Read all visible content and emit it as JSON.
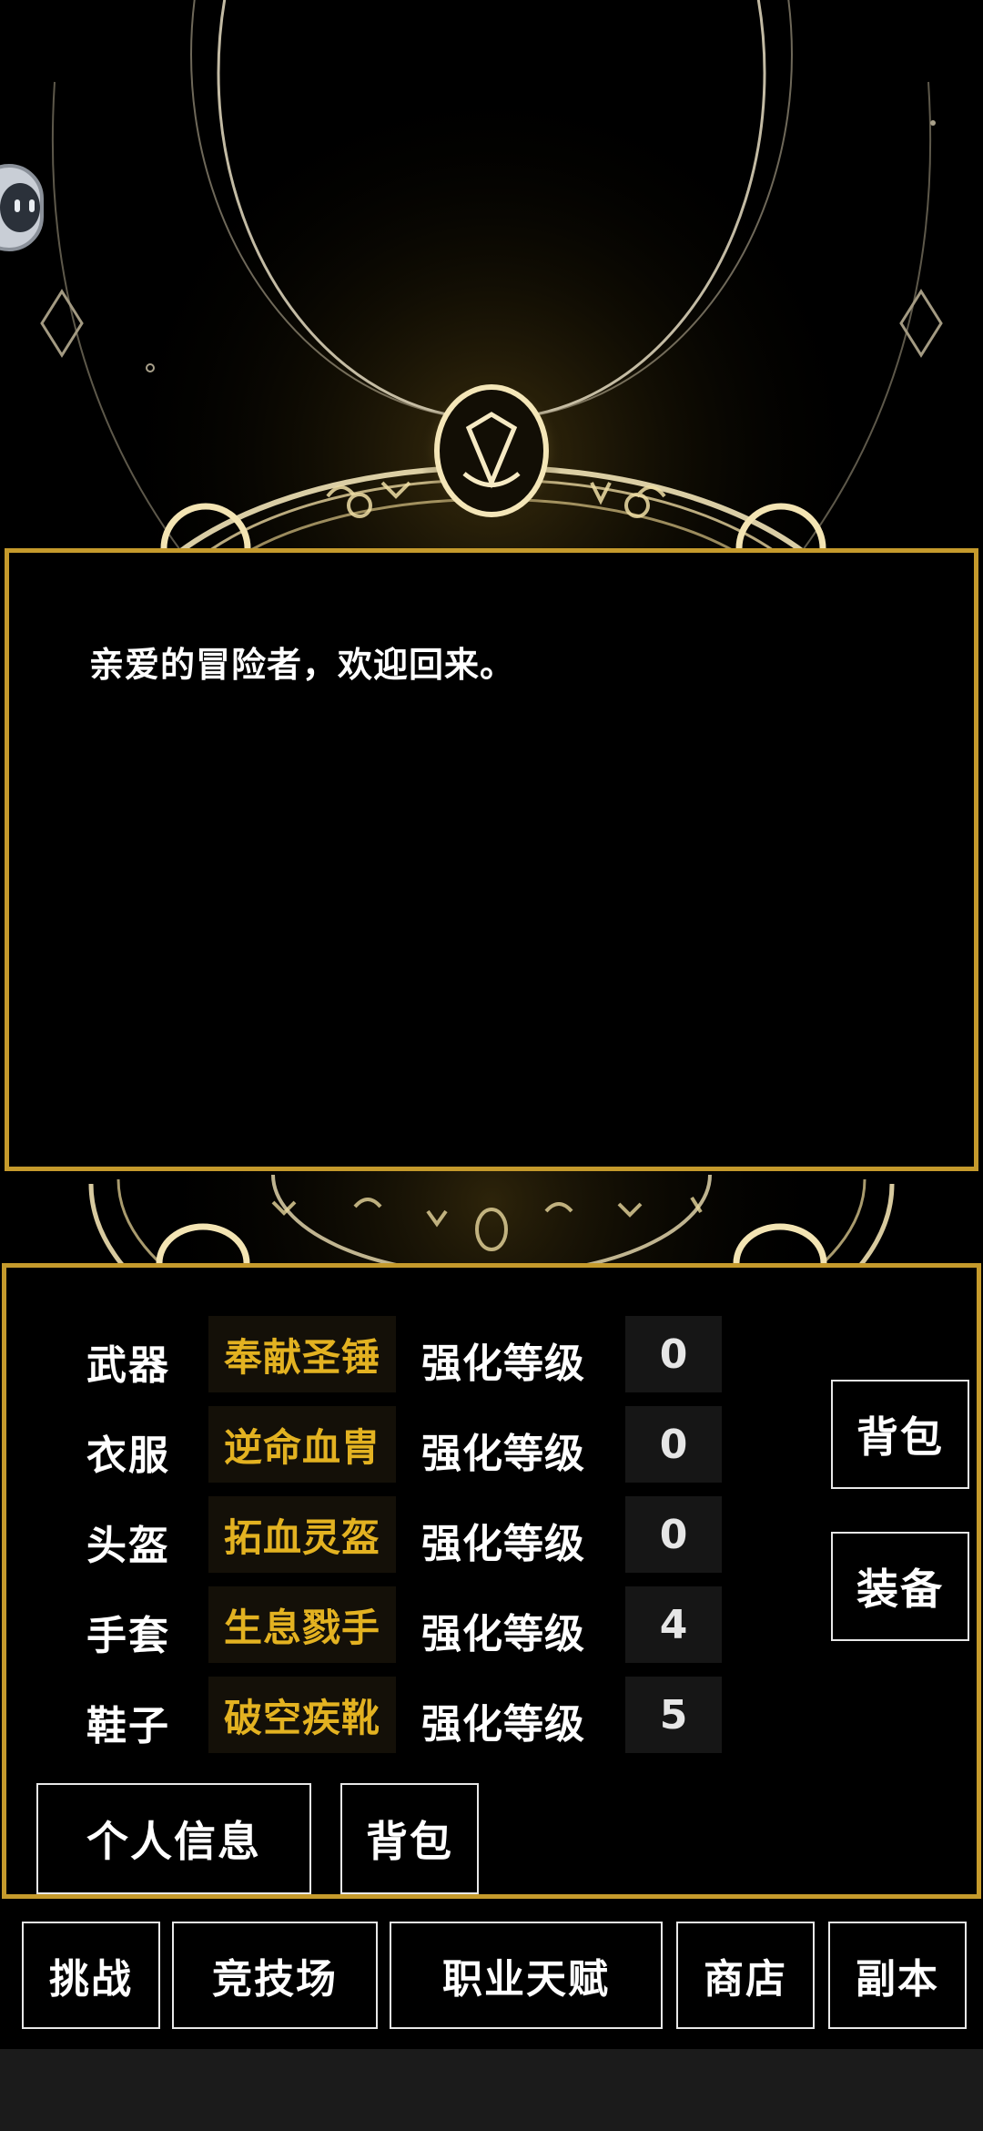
{
  "message": {
    "text": "亲爱的冒险者，欢迎回来。"
  },
  "equipment": {
    "rows": [
      {
        "slot": "武器",
        "item": "奉献圣锤",
        "level_label": "强化等级",
        "level": "0"
      },
      {
        "slot": "衣服",
        "item": "逆命血胄",
        "level_label": "强化等级",
        "level": "0"
      },
      {
        "slot": "头盔",
        "item": "拓血灵盔",
        "level_label": "强化等级",
        "level": "0"
      },
      {
        "slot": "手套",
        "item": "生息戮手",
        "level_label": "强化等级",
        "level": "4"
      },
      {
        "slot": "鞋子",
        "item": "破空疾靴",
        "level_label": "强化等级",
        "level": "5"
      }
    ],
    "side_buttons": {
      "bag": "背包",
      "equip": "装备"
    },
    "bottom_buttons": {
      "profile": "个人信息",
      "bag": "背包"
    }
  },
  "nav": {
    "items": [
      {
        "label": "挑战"
      },
      {
        "label": "竞技场"
      },
      {
        "label": "职业天赋"
      },
      {
        "label": "商店"
      },
      {
        "label": "副本"
      }
    ]
  },
  "colors": {
    "panel_border": "#c59a2c",
    "item_name": "#e3b221",
    "background": "#000000"
  },
  "icons": {
    "assistant": "robot-face-icon",
    "background_art": "magic-circle"
  }
}
